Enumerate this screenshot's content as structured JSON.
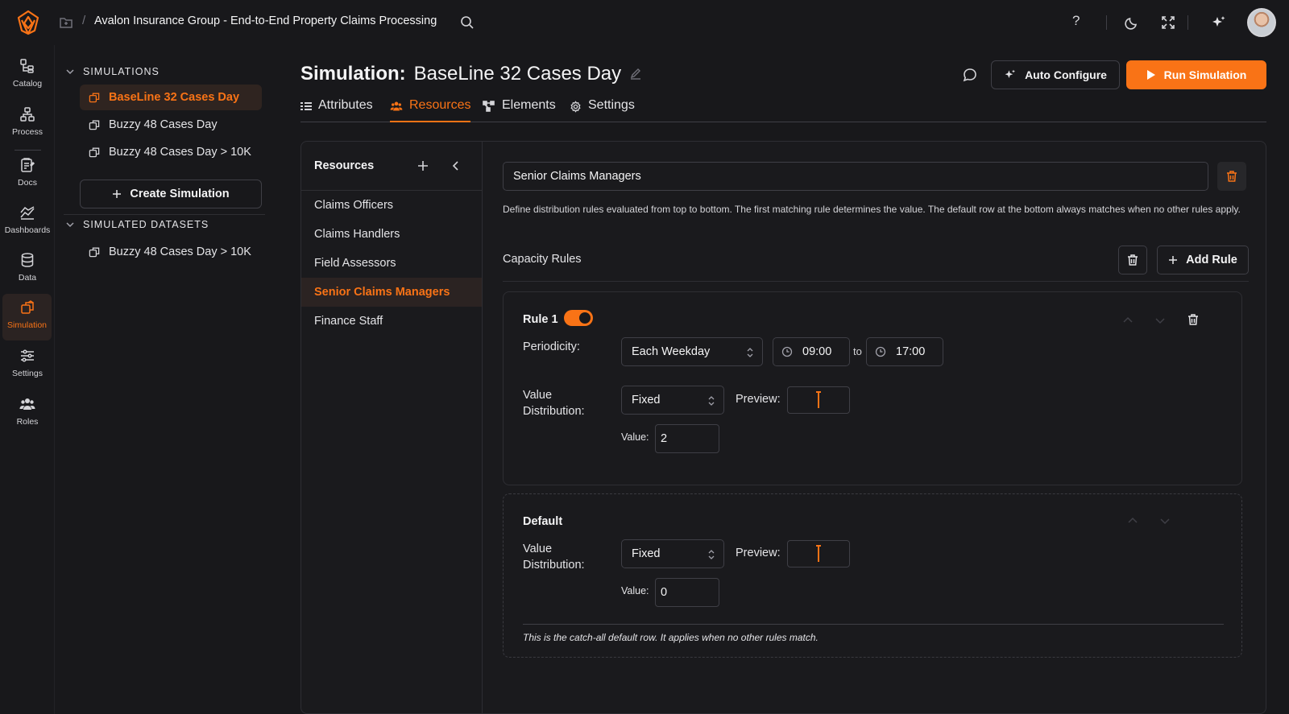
{
  "header": {
    "breadcrumb_sep": "/",
    "project_title": "Avalon Insurance Group - End-to-End Property Claims Processing",
    "help": "?"
  },
  "colors": {
    "accent": "#f97316",
    "background": "#18181b",
    "border": "#3f3f46"
  },
  "rail": {
    "items": [
      {
        "label": "Catalog",
        "icon": "catalog-icon"
      },
      {
        "label": "Process",
        "icon": "process-icon"
      },
      {
        "label": "Docs",
        "icon": "docs-icon"
      },
      {
        "label": "Dashboards",
        "icon": "dashboards-icon"
      },
      {
        "label": "Data",
        "icon": "database-icon"
      },
      {
        "label": "Simulation",
        "icon": "simulation-icon",
        "active": true
      },
      {
        "label": "Settings",
        "icon": "sliders-icon"
      },
      {
        "label": "Roles",
        "icon": "users-icon"
      }
    ]
  },
  "sidebar": {
    "simulations_heading": "SIMULATIONS",
    "simulations": [
      "BaseLine 32 Cases Day",
      "Buzzy 48 Cases Day",
      "Buzzy 48 Cases Day > 10K"
    ],
    "active_simulation": 0,
    "create_label": "Create Simulation",
    "datasets_heading": "SIMULATED DATASETS",
    "datasets": [
      "Buzzy 48 Cases Day > 10K"
    ]
  },
  "main": {
    "title_prefix": "Simulation:",
    "title_name": "BaseLine 32 Cases Day",
    "auto_configure_label": "Auto Configure",
    "run_label": "Run Simulation",
    "tabs": [
      "Attributes",
      "Resources",
      "Elements",
      "Settings"
    ],
    "active_tab": 1
  },
  "resources": {
    "heading": "Resources",
    "items": [
      "Claims Officers",
      "Claims Handlers",
      "Field Assessors",
      "Senior Claims Managers",
      "Finance Staff"
    ],
    "active_item": 3
  },
  "detail": {
    "name_value": "Senior Claims Managers",
    "description": "Define distribution rules evaluated from top to bottom. The first matching rule determines the value. The default row at the bottom always matches when no other rules apply.",
    "capacity_label": "Capacity Rules",
    "add_rule_label": "Add Rule",
    "rule1": {
      "title": "Rule 1",
      "enabled": true,
      "periodicity_label": "Periodicity:",
      "periodicity_value": "Each Weekday",
      "time_from": "09:00",
      "time_to_label": "to",
      "time_to": "17:00",
      "dist_label_line1": "Value",
      "dist_label_line2": "Distribution:",
      "dist_value": "Fixed",
      "preview_label": "Preview:",
      "value_label": "Value:",
      "value": "2"
    },
    "default_rule": {
      "title": "Default",
      "dist_label_line1": "Value",
      "dist_label_line2": "Distribution:",
      "dist_value": "Fixed",
      "preview_label": "Preview:",
      "value_label": "Value:",
      "value": "0",
      "note": "This is the catch-all default row. It applies when no other rules match."
    }
  }
}
